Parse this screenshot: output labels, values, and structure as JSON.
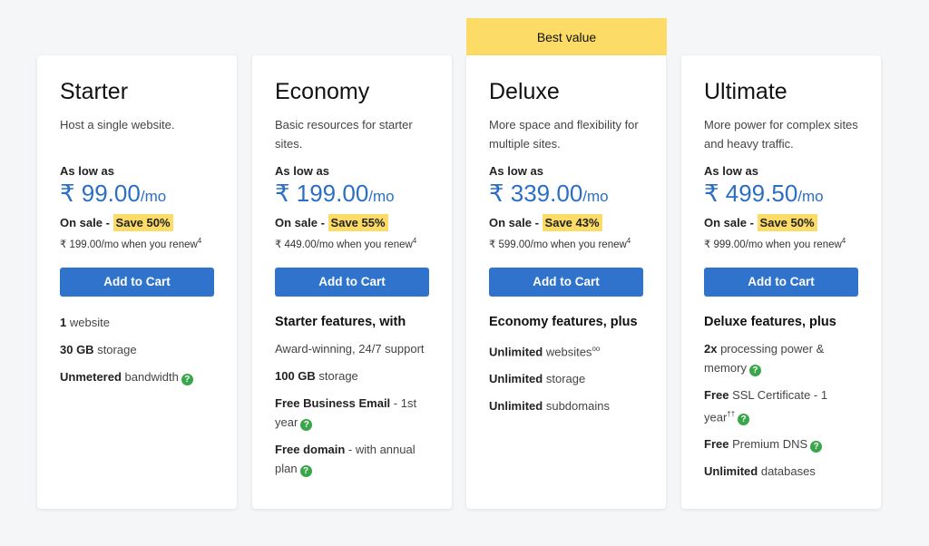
{
  "badge": {
    "label": "Best value",
    "color": "#fcdb66"
  },
  "accent": {
    "price": "#2b6fc4",
    "button": "#2f73cc",
    "help": "#3aa64a"
  },
  "plans": [
    {
      "name": "Starter",
      "description": "Host a single website.",
      "low_label": "As low as",
      "price": "₹ 99.00",
      "per": "/mo",
      "sale_label": "On sale -",
      "save": "Save 50%",
      "renew": "₹ 199.00/mo when you renew",
      "renew_note": "4",
      "cta": "Add to Cart",
      "features_heading": "",
      "features": [
        {
          "strong": "1",
          "text": " website",
          "help": false
        },
        {
          "strong": "30 GB",
          "text": " storage",
          "help": false
        },
        {
          "strong": "Unmetered",
          "text": " bandwidth",
          "help": true
        }
      ]
    },
    {
      "name": "Economy",
      "description": "Basic resources for starter sites.",
      "low_label": "As low as",
      "price": "₹ 199.00",
      "per": "/mo",
      "sale_label": "On sale -",
      "save": "Save 55%",
      "renew": "₹ 449.00/mo when you renew",
      "renew_note": "4",
      "cta": "Add to Cart",
      "features_heading": "Starter features, with",
      "features": [
        {
          "strong": "",
          "text": "Award-winning, 24/7 support",
          "help": false
        },
        {
          "strong": "100 GB",
          "text": " storage",
          "help": false
        },
        {
          "strong": "Free Business Email",
          "text": " - 1st year",
          "help": true
        },
        {
          "strong": "Free domain",
          "text": " - with annual plan",
          "help": true
        }
      ]
    },
    {
      "name": "Deluxe",
      "description": "More space and flexibility for multiple sites.",
      "low_label": "As low as",
      "price": "₹ 339.00",
      "per": "/mo",
      "sale_label": "On sale -",
      "save": "Save 43%",
      "renew": "₹ 599.00/mo when you renew",
      "renew_note": "4",
      "cta": "Add to Cart",
      "features_heading": "Economy features, plus",
      "features": [
        {
          "strong": "Unlimited",
          "text": " websites",
          "sup": "oo",
          "help": false
        },
        {
          "strong": "Unlimited",
          "text": " storage",
          "help": false
        },
        {
          "strong": "Unlimited",
          "text": " subdomains",
          "help": false
        }
      ]
    },
    {
      "name": "Ultimate",
      "description": "More power for complex sites and heavy traffic.",
      "low_label": "As low as",
      "price": "₹ 499.50",
      "per": "/mo",
      "sale_label": "On sale -",
      "save": "Save 50%",
      "renew": "₹ 999.00/mo when you renew",
      "renew_note": "4",
      "cta": "Add to Cart",
      "features_heading": "Deluxe features, plus",
      "features": [
        {
          "strong": "2x",
          "text": " processing power & memory",
          "help": true
        },
        {
          "strong": "Free",
          "text": " SSL Certificate - 1 year",
          "sup": "††",
          "help": true
        },
        {
          "strong": "Free",
          "text": " Premium DNS",
          "help": true
        },
        {
          "strong": "Unlimited",
          "text": " databases",
          "help": false
        }
      ]
    }
  ]
}
